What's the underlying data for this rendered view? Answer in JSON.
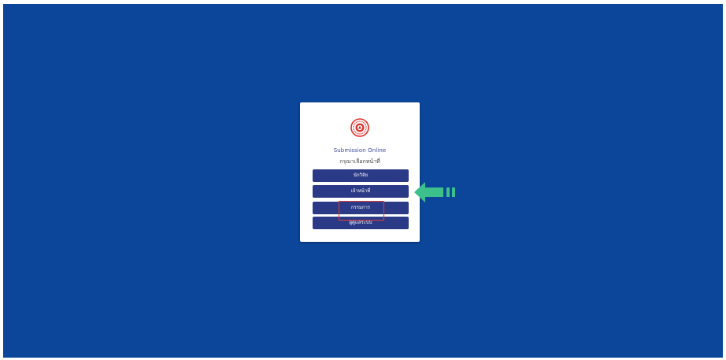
{
  "app": {
    "title": "Submission Online",
    "subtitle": "กรุณาเลือกหน้าที่"
  },
  "roles": [
    {
      "label": "นักวิจัย"
    },
    {
      "label": "เจ้าหน้าที่"
    },
    {
      "label": "กรรมการ"
    },
    {
      "label": "ผู้ดูแลระบบ"
    }
  ],
  "colors": {
    "background": "#0b469a",
    "button": "#2b3a86",
    "highlight": "#e23a3a",
    "arrow": "#3cc08c",
    "logo": "#d9312b"
  },
  "icons": {
    "logo": "university-seal-icon",
    "pointer": "arrow-left-icon"
  }
}
